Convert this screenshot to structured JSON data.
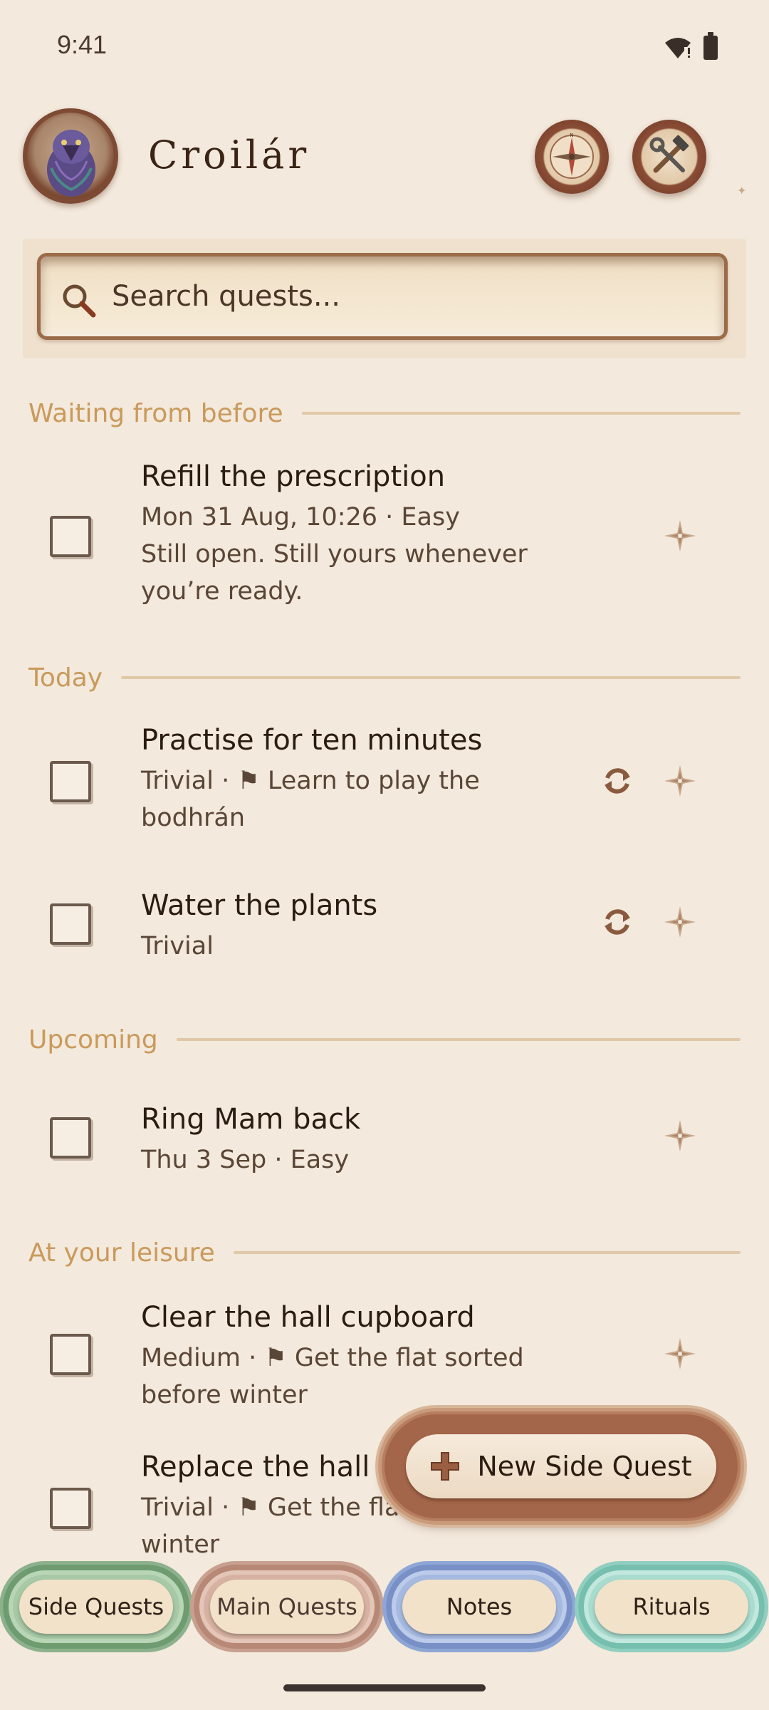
{
  "status_bar": {
    "time": "9:41"
  },
  "header": {
    "app_title": "Croilár",
    "avatar_icon": "raven-icon",
    "compass_icon": "compass-icon",
    "tools_icon": "hammer-wrench-icon"
  },
  "search": {
    "placeholder": "Search quests..."
  },
  "sections": [
    {
      "title": "Waiting from before"
    },
    {
      "title": "Today"
    },
    {
      "title": "Upcoming"
    },
    {
      "title": "At your leisure"
    }
  ],
  "tasks": [
    {
      "title": "Refill the prescription",
      "meta_line1": "Mon 31 Aug, 10:26 · Easy",
      "meta_line2": "Still open. Still yours whenever you’re ready.",
      "recurring": false
    },
    {
      "title": "Practise for ten minutes",
      "difficulty": "Trivial · ",
      "quest": "Learn to play the bodhrán",
      "recurring": true
    },
    {
      "title": "Water the plants",
      "meta_line1": "Trivial",
      "recurring": true
    },
    {
      "title": "Ring Mam back",
      "meta_line1": "Thu 3 Sep · Easy",
      "recurring": false
    },
    {
      "title": "Clear the hall cupboard",
      "difficulty": "Medium · ",
      "quest": "Get the flat sorted before winter",
      "recurring": false
    },
    {
      "title": "Replace the hall bulb",
      "difficulty": "Trivial · ",
      "quest": "Get the flat sorted before winter",
      "recurring": false
    }
  ],
  "fab": {
    "label": "New Side Quest"
  },
  "bottom_nav": {
    "items": [
      "Side Quests",
      "Main Quests",
      "Notes",
      "Rituals"
    ],
    "colors": [
      "#a7c9a6",
      "#d7b2a2",
      "#a6b9e0",
      "#a9dccf"
    ]
  },
  "colors": {
    "background": "#f3e9dc",
    "section_accent": "#c99a5c",
    "brand_brown": "#7e4a34"
  }
}
